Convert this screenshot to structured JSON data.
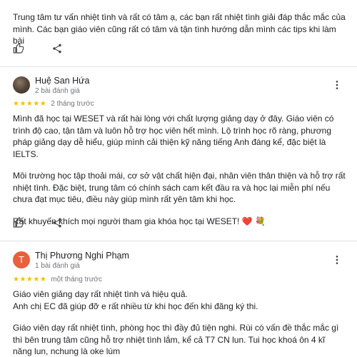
{
  "review0": {
    "text": "Trung tâm tư vấn nhiệt tình và rất có tâm ạ, các bạn rất nhiệt tình giải đáp thắc mắc của mình. Các bạn giáo viên cũng rất có tâm và tận tình hướng dẫn mình các tips khi làm bài"
  },
  "review1": {
    "name": "Huệ San Hứa",
    "subtitle": "2 bài đánh giá",
    "stars": "★★★★★",
    "date": "2 tháng trước",
    "paragraphs": [
      "Mình đã học tại WESET và rất hài lòng với chất lượng giảng dạy ở đây. Giáo viên có trình độ cao, tận tâm và luôn hỗ trợ học viên hết mình. Lộ trình học rõ ràng, phương pháp giảng dạy dễ hiểu, giúp mình cải thiện kỹ năng tiếng Anh đáng kể, đặc biệt là IELTS.",
      "Môi trường học tập thoải mái, cơ sở vật chất hiện đại, nhân viên thân thiện và hỗ trợ rất nhiệt tình. Đặc biệt, trung tâm có chính sách cam kết đầu ra và học lại miễn phí nếu chưa đạt mục tiêu, điều này giúp mình rất yên tâm khi học.",
      "Rất khuyến khích mọi người tham gia khóa học tại WESET! ❤️ 💐"
    ]
  },
  "review2": {
    "avatar_letter": "T",
    "name": "Thị Phương Nghi Phạm",
    "subtitle": "1 bài đánh giá",
    "stars": "★★★★★",
    "date": "một tháng trước",
    "paragraphs": [
      "Giáo viên giảng dạy rất nhiệt tình và hiệu quả.\nAnh chị EC đã giúp đỡ e rất nhiều từ khi học đến khi đăng ký thi.",
      "Giáo viên dạy rất nhiệt tình, phòng học thì đầy đủ tiện nghi. Rùi có vấn đề thắc mắc gì thì bên trung tâm cũng hỗ trợ nhiệt tình lắm, kể cả T7 CN lun. Tui học khoá ôn 4 kĩ năng lun, nchung là oke lúm"
    ]
  },
  "icons": {
    "like": "thumbs-up-icon",
    "share": "share-icon",
    "more": "more-vert-icon",
    "star_color": "#fbbc04",
    "avatar_t_color": "#e8603c"
  }
}
